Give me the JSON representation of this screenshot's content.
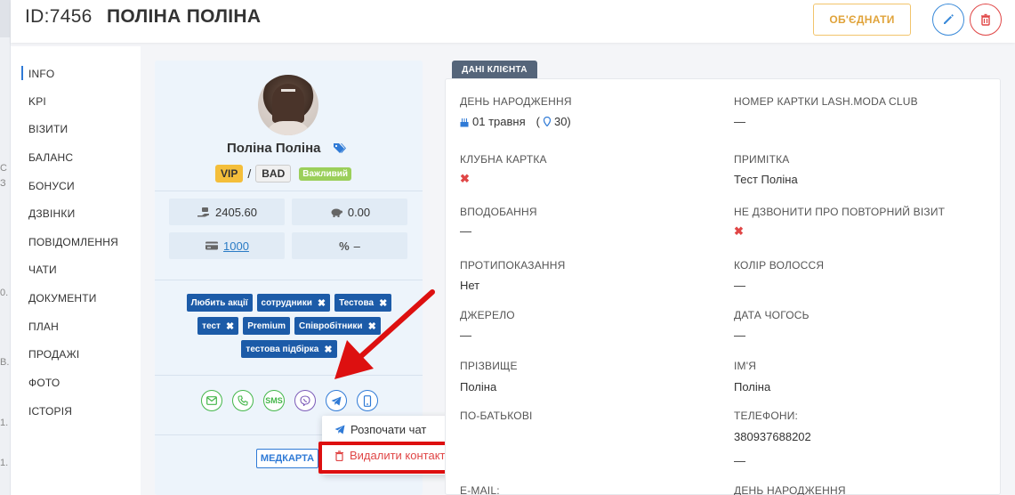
{
  "header": {
    "id_label": "ID:7456",
    "client_name": "ПОЛІНА ПОЛІНА",
    "merge_label": "ОБ'ЄДНАТИ"
  },
  "backdrop": {
    "fragments": [
      "С",
      "З",
      "0.",
      "В.",
      "1.",
      "1."
    ]
  },
  "nav": {
    "items": [
      "INFO",
      "KPI",
      "ВІЗИТИ",
      "БАЛАНС",
      "БОНУСИ",
      "ДЗВІНКИ",
      "ПОВІДОМЛЕННЯ",
      "ЧАТИ",
      "ДОКУМЕНТИ",
      "ПЛАН",
      "ПРОДАЖІ",
      "ФОТО",
      "ІСТОРІЯ"
    ],
    "active": "INFO"
  },
  "profile": {
    "name": "Поліна Поліна",
    "badges": {
      "vip": "VIP",
      "separator": "/",
      "bad": "BAD",
      "important": "Важливий"
    },
    "stats": {
      "balance": "2405.60",
      "savings": "0.00",
      "card": "1000",
      "discount": "–"
    },
    "tags": [
      "Любить акції",
      "сотрудники",
      "Тестова",
      "тест",
      "Premium",
      "Співробітники",
      "тестова підбірка"
    ],
    "comm": {
      "sms": "SMS"
    },
    "medcard_label": "МЕДКАРТА"
  },
  "context_menu": {
    "start_chat": "Розпочати чат",
    "delete_contact": "Видалити контакт"
  },
  "client_data": {
    "tab": "ДАНІ КЛІЄНТА",
    "fields": {
      "birthday_label": "ДЕНЬ НАРОДЖЕННЯ",
      "birthday_value": "01 травня",
      "birthday_age": "30)",
      "card_num_label": "НОМЕР КАРТКИ LASH.MODA CLUB",
      "card_num_value": "—",
      "club_card_label": "КЛУБНА КАРТКА",
      "note_label": "ПРИМІТКА",
      "note_value": "Тест Поліна",
      "likes_label": "ВПОДОБАННЯ",
      "likes_value": "—",
      "no_call_label": "НЕ ДЗВОНИТИ ПРО ПОВТОРНИЙ ВІЗИТ",
      "contra_label": "ПРОТИПОКАЗАННЯ",
      "contra_value": "Нет",
      "hair_label": "КОЛІР ВОЛОССЯ",
      "hair_value": "—",
      "source_label": "ДЖЕРЕЛО",
      "source_value": "—",
      "date_label": "ДАТА ЧОГОСЬ",
      "date_value": "—",
      "surname_label": "ПРІЗВИЩЕ",
      "surname_value": "Поліна",
      "firstname_label": "ІМ'Я",
      "firstname_value": "Поліна",
      "patronymic_label": "ПО-БАТЬКОВІ",
      "phones_label": "ТЕЛЕФОНИ:",
      "phone_1": "380937688202",
      "phone_2": "—",
      "email_label": "E-MAIL:",
      "birthday2_label": "ДЕНЬ НАРОДЖЕННЯ"
    }
  },
  "colors": {
    "accent": "#2f7ad6",
    "danger": "#e04646",
    "merge": "#e0a33a",
    "tag": "#1c5ba8"
  }
}
